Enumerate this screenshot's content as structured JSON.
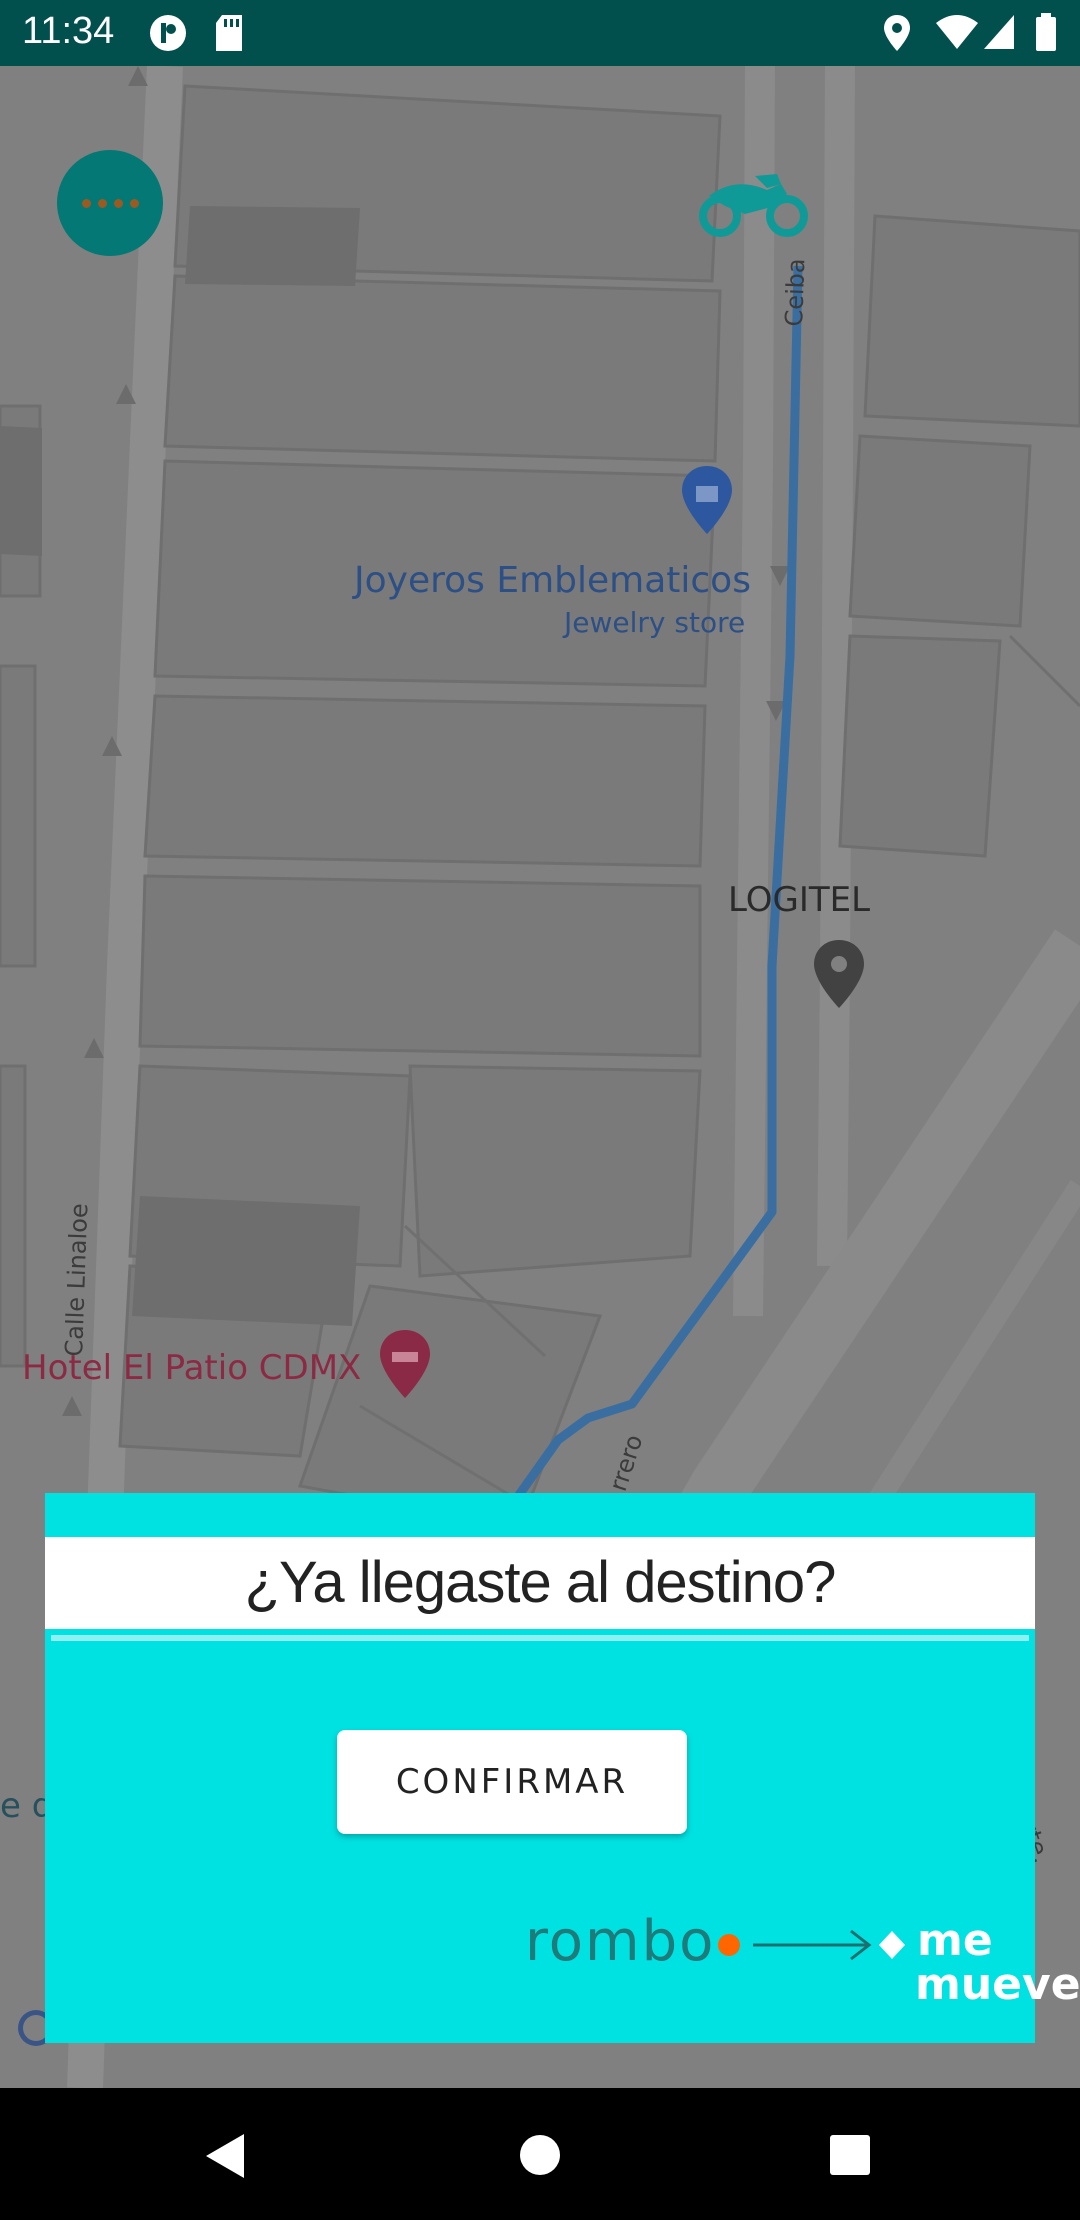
{
  "status_bar": {
    "time": "11:34",
    "icons": [
      "notification-p-icon",
      "sd-card-icon",
      "location-icon",
      "wifi-icon",
      "signal-icon",
      "battery-icon"
    ]
  },
  "map": {
    "places": [
      {
        "name": "Joyeros Emblematicos",
        "category": "Jewelry store",
        "pin": "shopping-pin-icon"
      },
      {
        "name": "LOGITEL",
        "pin": "place-pin-icon"
      },
      {
        "name": "Hotel El Patio CDMX",
        "pin": "hotel-pin-icon"
      }
    ],
    "streets": [
      "Ceiba",
      "Calle Linaloe",
      "rrero",
      "vte."
    ],
    "edge_text": "e de",
    "vehicle_icon": "motorcycle-icon",
    "colors": {
      "route": "#3a6ea0",
      "vehicle": "#0f9a97"
    }
  },
  "menu_button": {
    "icon": "more-dots-icon"
  },
  "dialog": {
    "title": "¿Ya llegaste al destino?",
    "confirm_label": "CONFIRMAR",
    "logo": {
      "word1": "rombo",
      "word2": "me",
      "word3": "mueve"
    },
    "colors": {
      "background": "#00e1e1",
      "logo_accent": "#ff6600"
    }
  },
  "nav_bar": {
    "icons": [
      "back-icon",
      "home-icon",
      "recents-icon"
    ]
  }
}
